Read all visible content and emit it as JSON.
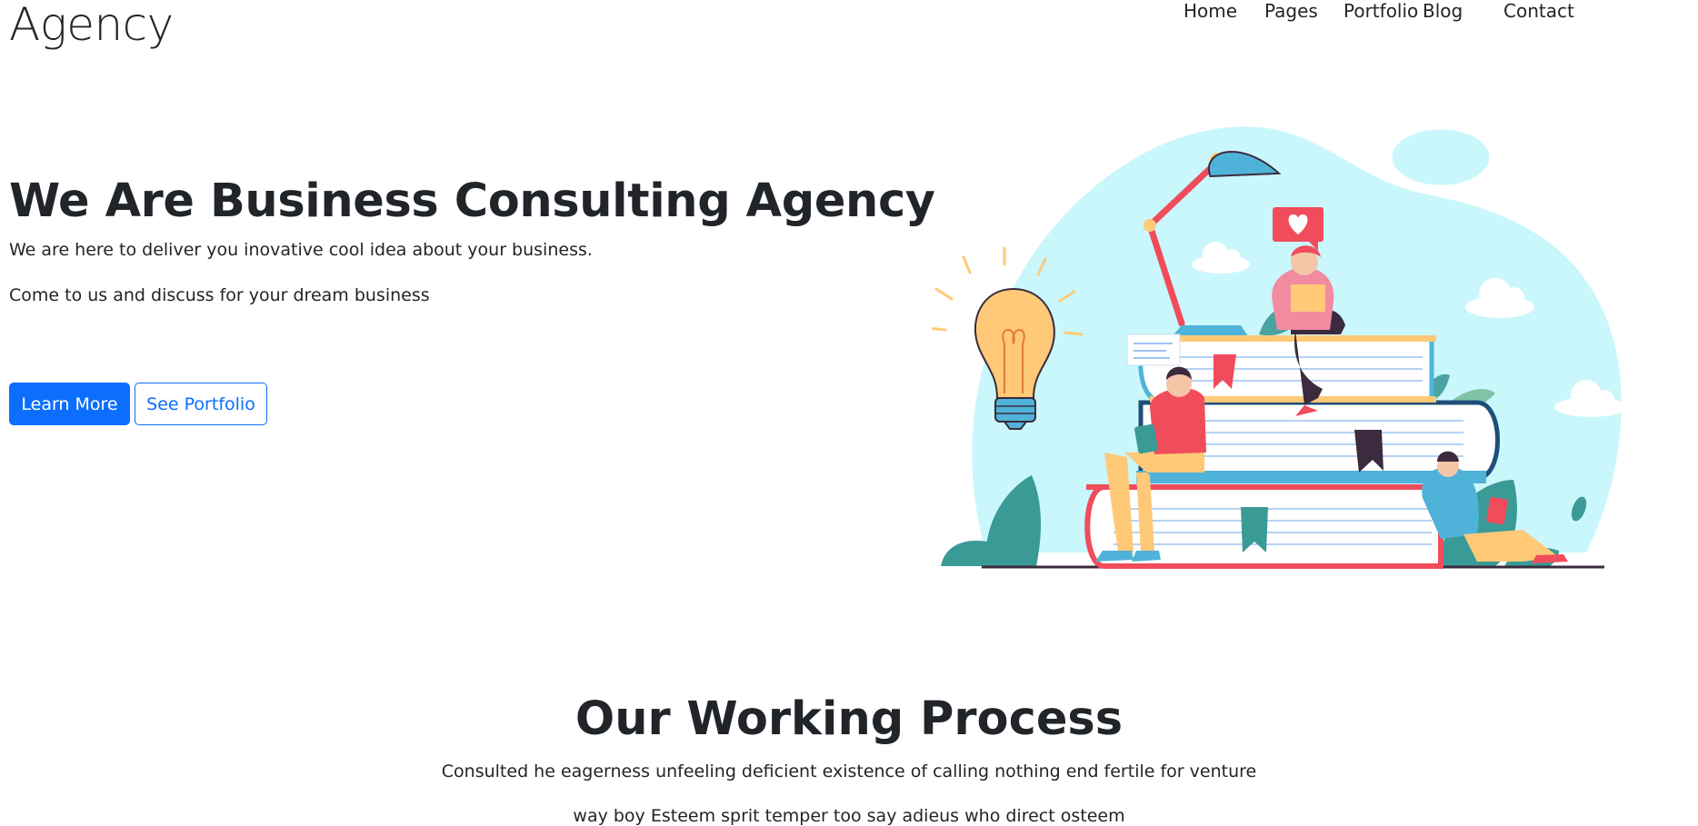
{
  "brand": "Agency",
  "nav": [
    "Home",
    "Pages",
    "Portfolio",
    "Blog",
    "Contact"
  ],
  "hero": {
    "title": "We Are Business Consulting Agency",
    "line1": "We are here to deliver you inovative cool idea about your business.",
    "line2": "Come to us and discuss for your dream business",
    "primary_button": "Learn More",
    "secondary_button": "See Portfolio"
  },
  "illustration": {
    "icons": [
      "lightbulb-icon",
      "desk-lamp-icon",
      "heart-chat-icon",
      "book-stack-icon",
      "cloud-icon",
      "plant-icon"
    ],
    "colors": {
      "blob": "#c9f7fb",
      "accent_red": "#f04c5c",
      "teal": "#3a9a96",
      "blue": "#4fb3d9",
      "yellow": "#ffc978"
    }
  },
  "process": {
    "title": "Our Working Process",
    "line1": "Consulted he eagerness unfeeling deficient existence of calling nothing end fertile for venture",
    "line2": "way boy Esteem sprit temper too say adieus who direct osteem"
  },
  "colors": {
    "primary": "#0d6efd",
    "text": "#212529"
  }
}
